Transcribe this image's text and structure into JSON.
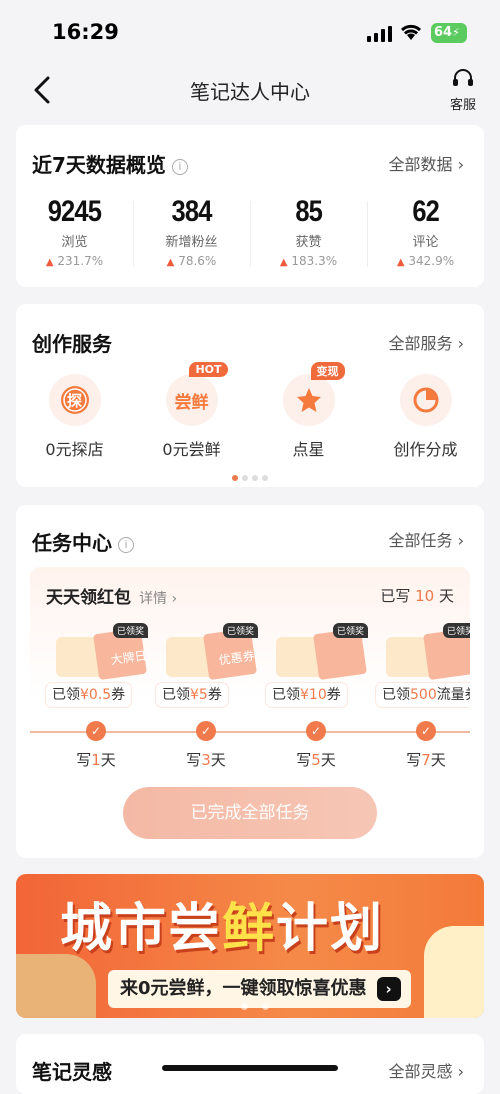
{
  "status_bar": {
    "time": "16:29",
    "battery": "64"
  },
  "navbar": {
    "title": "笔记达人中心",
    "customer_service": "客服"
  },
  "overview": {
    "title": "近7天数据概览",
    "more": "全部数据 ›",
    "stats": [
      {
        "value": "9245",
        "name": "浏览",
        "change": "231.7%"
      },
      {
        "value": "384",
        "name": "新增粉丝",
        "change": "78.6%"
      },
      {
        "value": "85",
        "name": "获赞",
        "change": "183.3%"
      },
      {
        "value": "62",
        "name": "评论",
        "change": "342.9%"
      }
    ]
  },
  "services": {
    "title": "创作服务",
    "more": "全部服务 ›",
    "items": [
      {
        "label": "0元探店",
        "icon": "探"
      },
      {
        "label": "0元尝鲜",
        "icon": "尝鲜",
        "badge": "HOT"
      },
      {
        "label": "点星",
        "badge": "变现"
      },
      {
        "label": "创作分成"
      }
    ]
  },
  "tasks": {
    "title": "任务中心",
    "more": "全部任务 ›",
    "redpack": {
      "title": "天天领红包",
      "detail": "详情 ›",
      "written_prefix": "已写",
      "written_days": "10",
      "written_suffix": "天",
      "got_label": "已领奖",
      "rewards": [
        {
          "prefix": "已领",
          "value": "¥0.5",
          "suffix": "券",
          "pic_text": "大牌日"
        },
        {
          "prefix": "已领",
          "value": "¥5",
          "suffix": "券",
          "pic_text": "优惠券"
        },
        {
          "prefix": "已领",
          "value": "¥10",
          "suffix": "券",
          "pic_text": ""
        },
        {
          "prefix": "已领",
          "value": "500",
          "suffix": "流量券",
          "pic_text": ""
        }
      ],
      "days": [
        {
          "prefix": "写",
          "n": "1",
          "suffix": "天"
        },
        {
          "prefix": "写",
          "n": "3",
          "suffix": "天"
        },
        {
          "prefix": "写",
          "n": "5",
          "suffix": "天"
        },
        {
          "prefix": "写",
          "n": "7",
          "suffix": "天"
        }
      ]
    },
    "done_button": "已完成全部任务"
  },
  "banner": {
    "title_a": "城市尝",
    "title_hi": "鲜",
    "title_b": "计划",
    "subtitle": "来0元尝鲜，一键领取惊喜优惠"
  },
  "inspiration": {
    "title": "笔记灵感",
    "more": "全部灵感 ›"
  },
  "colors": {
    "accent": "#f07a4c",
    "background": "#f4f4f6"
  }
}
